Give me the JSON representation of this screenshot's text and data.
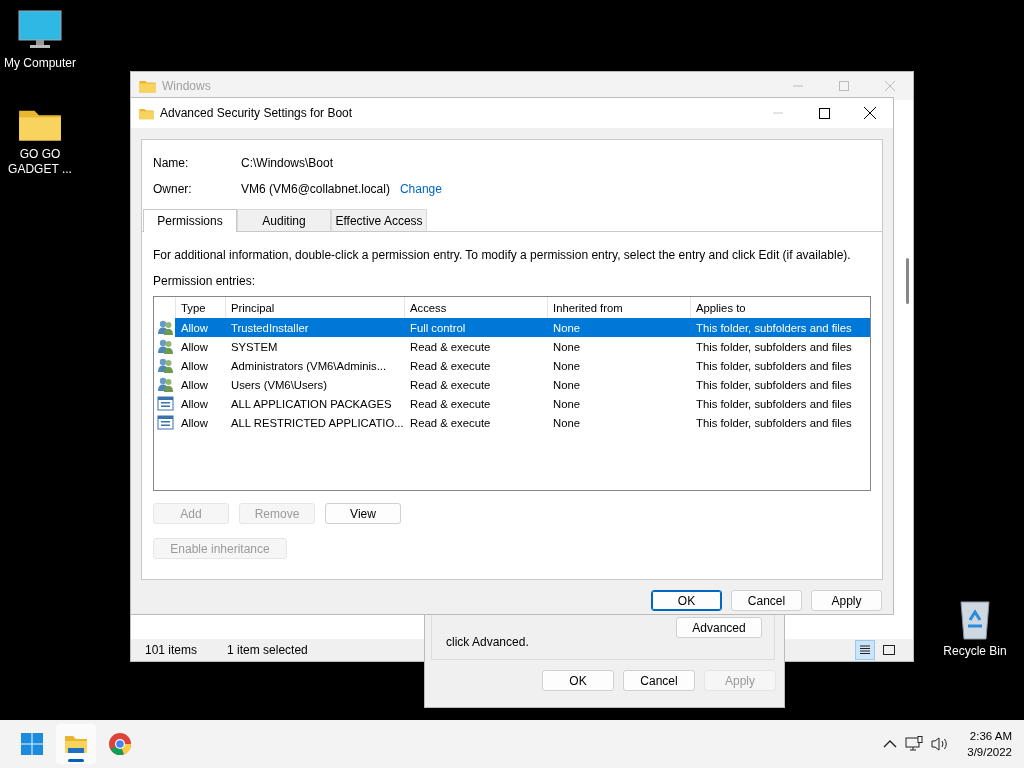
{
  "desktop_icons": [
    {
      "label": "My Computer",
      "kind": "computer"
    },
    {
      "label": "GO GO GADGET ...",
      "kind": "folder"
    }
  ],
  "recycle_bin": {
    "label": "Recycle Bin"
  },
  "explorer_window": {
    "title": "Windows",
    "status_bar": {
      "item_count": "101 items",
      "selection": "1 item selected"
    },
    "view_modes": [
      {
        "kind": "details",
        "selected": true
      },
      {
        "kind": "tiles",
        "selected": false
      }
    ]
  },
  "properties_dialog": {
    "text": "click Advanced.",
    "advanced_button": "Advanced",
    "buttons": [
      {
        "label": "OK",
        "disabled": false
      },
      {
        "label": "Cancel",
        "disabled": false
      },
      {
        "label": "Apply",
        "disabled": true
      }
    ]
  },
  "security_dialog": {
    "title": "Advanced Security Settings for Boot",
    "name_label": "Name:",
    "name_value": "C:\\Windows\\Boot",
    "owner_label": "Owner:",
    "owner_value": "VM6 (VM6@collabnet.local)",
    "change_link": "Change",
    "tabs": [
      {
        "label": "Permissions",
        "selected": true
      },
      {
        "label": "Auditing",
        "selected": false
      },
      {
        "label": "Effective Access",
        "selected": false
      }
    ],
    "description": "For additional information, double-click a permission entry. To modify a permission entry, select the entry and click Edit (if available).",
    "entries_label": "Permission entries:",
    "columns": [
      "Type",
      "Principal",
      "Access",
      "Inherited from",
      "Applies to"
    ],
    "rows": [
      {
        "kind": "group",
        "selected": true,
        "cells": [
          "Allow",
          "TrustedInstaller",
          "Full control",
          "None",
          "This folder, subfolders and files"
        ]
      },
      {
        "kind": "group",
        "selected": false,
        "cells": [
          "Allow",
          "SYSTEM",
          "Read & execute",
          "None",
          "This folder, subfolders and files"
        ]
      },
      {
        "kind": "group",
        "selected": false,
        "cells": [
          "Allow",
          "Administrators (VM6\\Adminis...",
          "Read & execute",
          "None",
          "This folder, subfolders and files"
        ]
      },
      {
        "kind": "group",
        "selected": false,
        "cells": [
          "Allow",
          "Users (VM6\\Users)",
          "Read & execute",
          "None",
          "This folder, subfolders and files"
        ]
      },
      {
        "kind": "package",
        "selected": false,
        "cells": [
          "Allow",
          "ALL APPLICATION PACKAGES",
          "Read & execute",
          "None",
          "This folder, subfolders and files"
        ]
      },
      {
        "kind": "package",
        "selected": false,
        "cells": [
          "Allow",
          "ALL RESTRICTED APPLICATIO...",
          "Read & execute",
          "None",
          "This folder, subfolders and files"
        ]
      }
    ],
    "entry_buttons": [
      {
        "label": "Add",
        "disabled": true
      },
      {
        "label": "Remove",
        "disabled": true
      },
      {
        "label": "View",
        "disabled": false
      }
    ],
    "inheritance_button": {
      "label": "Enable inheritance",
      "disabled": true
    },
    "footer_buttons": [
      {
        "label": "OK",
        "default": true
      },
      {
        "label": "Cancel",
        "default": false
      },
      {
        "label": "Apply",
        "default": false
      }
    ]
  },
  "taskbar": {
    "apps": [
      {
        "kind": "explorer",
        "active": true
      },
      {
        "kind": "chrome",
        "active": false
      }
    ],
    "time": "2:36 AM",
    "date": "3/9/2022"
  }
}
